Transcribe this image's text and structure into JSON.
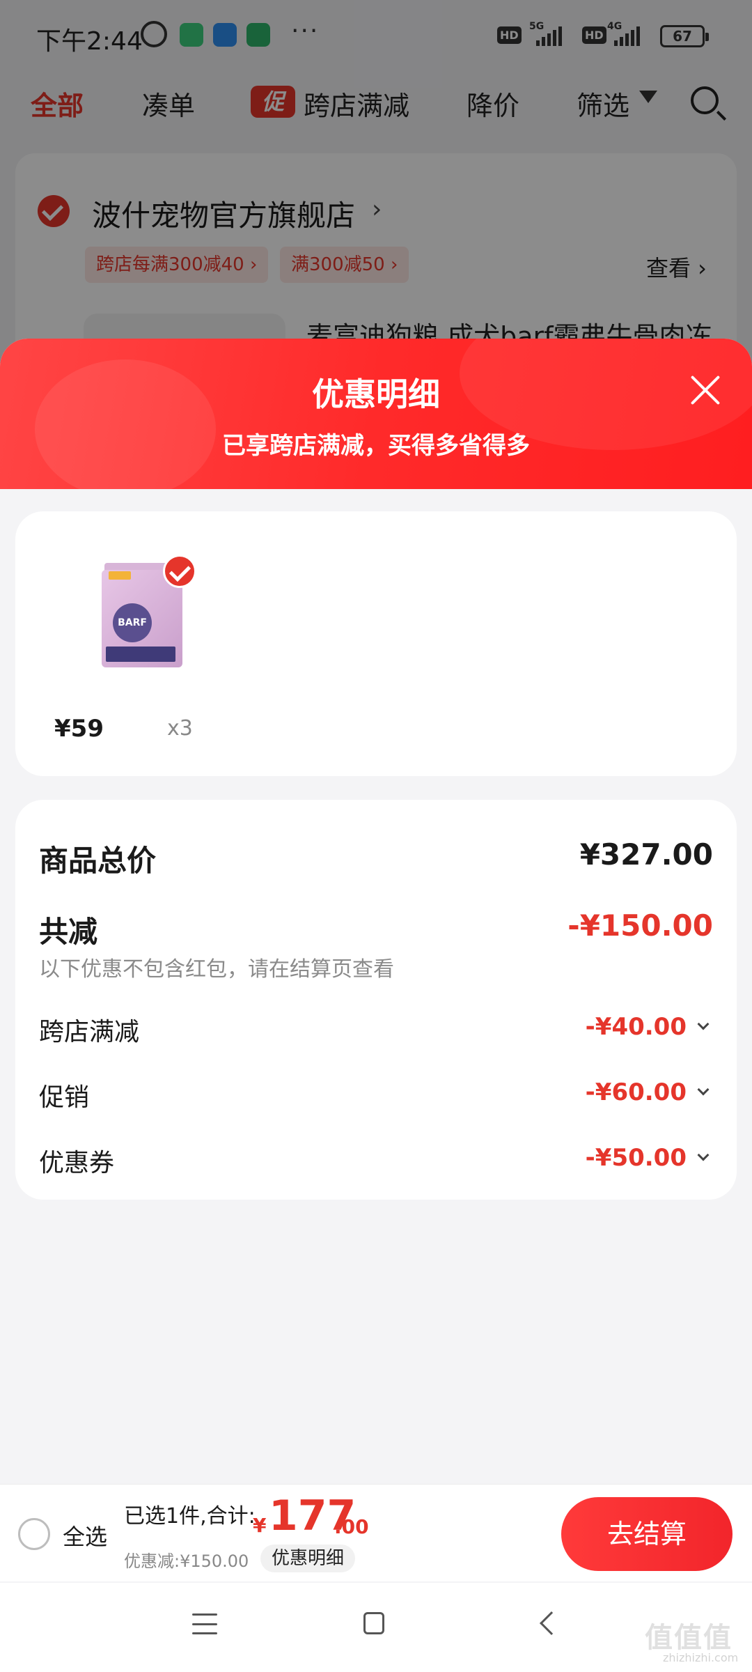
{
  "status_bar": {
    "time": "下午2:44",
    "dots": "···",
    "hd_label": "HD",
    "net_5g": "5G",
    "net_4g": "4G",
    "battery": "67",
    "app_colors": [
      "#3ccf7f",
      "#2f8ff0",
      "#2fb56a"
    ]
  },
  "top_tabs": {
    "all": "全部",
    "bundle": "凑单",
    "promo_badge": "促",
    "cross_store": "跨店满减",
    "price_drop": "降价",
    "filter": "筛选"
  },
  "store": {
    "name": "波什宠物官方旗舰店",
    "chevron": "›",
    "tags": [
      "跨店每满300减40 ›",
      "满300减50 ›"
    ],
    "view": "查看 ›",
    "product_title": "麦富迪狗粮 成犬barf霸弗牛骨肉冻"
  },
  "sheet": {
    "title": "优惠明细",
    "subtitle": "已享跨店满减，买得多省得多"
  },
  "item": {
    "package_text": "BARF",
    "price": "¥59",
    "qty": "x3"
  },
  "detail": {
    "total_label": "商品总价",
    "total_value": "¥327.00",
    "reduce_label": "共减",
    "reduce_value": "-¥150.00",
    "note": "以下优惠不包含红包，请在结算页查看",
    "items": [
      {
        "label": "跨店满减",
        "value": "-¥40.00"
      },
      {
        "label": "促销",
        "value": "-¥60.00"
      },
      {
        "label": "优惠券",
        "value": "-¥50.00"
      }
    ]
  },
  "bottom_bar": {
    "select_all": "全选",
    "selected_text": "已选1件,合计:",
    "currency": "¥",
    "total_int": "177",
    "total_dec": ".00",
    "discount_text": "优惠减:¥150.00",
    "detail_button": "优惠明细",
    "checkout": "去结算"
  },
  "watermark": {
    "text": "值值值",
    "url": "zhizhizhi.com"
  },
  "colors": {
    "accent_red": "#e5352b",
    "header_gradient": [
      "#ff4545",
      "#ff1e20"
    ]
  }
}
